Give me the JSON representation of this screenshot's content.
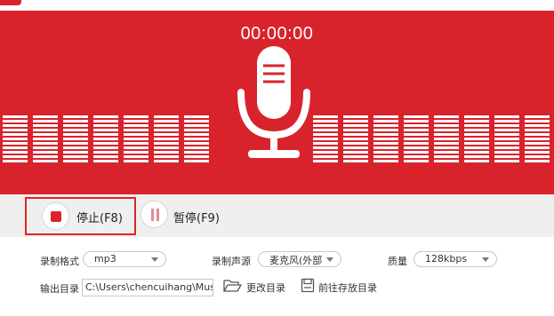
{
  "header": {
    "logo_icon": "app-logo-icon"
  },
  "recorder": {
    "timer": "00:00:00",
    "icon": "microphone-icon",
    "accent_color": "#d9232c"
  },
  "controls": {
    "stop_label": "停止(F8)",
    "stop_icon": "stop-icon",
    "pause_label": "暂停(F9)",
    "pause_icon": "pause-icon"
  },
  "settings": {
    "format_label": "录制格式",
    "format_value": "mp3",
    "source_label": "录制声源",
    "source_value": "麦克风(外部",
    "quality_label": "质量",
    "quality_value": "128kbps",
    "output_label": "输出目录",
    "output_path": "C:\\Users\\chencuihang\\Music",
    "change_dir_label": "更改目录",
    "change_dir_icon": "folder-open-icon",
    "open_dir_label": "前往存放目录",
    "open_dir_icon": "save-disk-icon"
  }
}
